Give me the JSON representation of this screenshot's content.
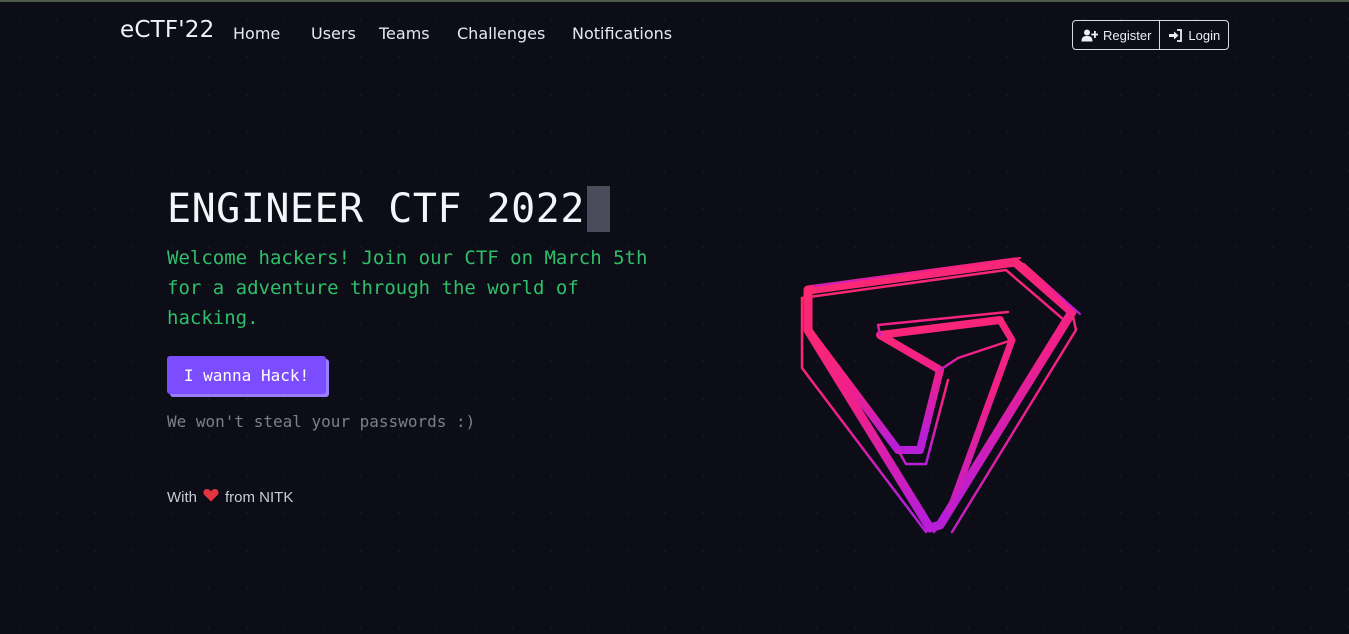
{
  "navbar": {
    "brand": "eCTF'22",
    "links": [
      "Home",
      "Users",
      "Teams",
      "Challenges",
      "Notifications"
    ],
    "register_label": "Register",
    "login_label": "Login"
  },
  "hero": {
    "title": "ENGINEER CTF 2022",
    "description": "Welcome hackers! Join our CTF on March 5th for a adventure through the world of hacking.",
    "cta_label": "I wanna Hack!",
    "disclaimer": "We won't steal your passwords :)",
    "credit_prefix": "With",
    "credit_suffix": "from NITK"
  },
  "icons": {
    "register": "user-plus-icon",
    "login": "sign-in-icon",
    "heart": "heart-icon",
    "logo": "triangle-logo"
  },
  "colors": {
    "background": "#0c0d16",
    "accent_green": "#2fbf6a",
    "button_purple": "#7c4dff",
    "logo_pink": "#ff2a6d",
    "logo_magenta": "#c21fd6"
  }
}
